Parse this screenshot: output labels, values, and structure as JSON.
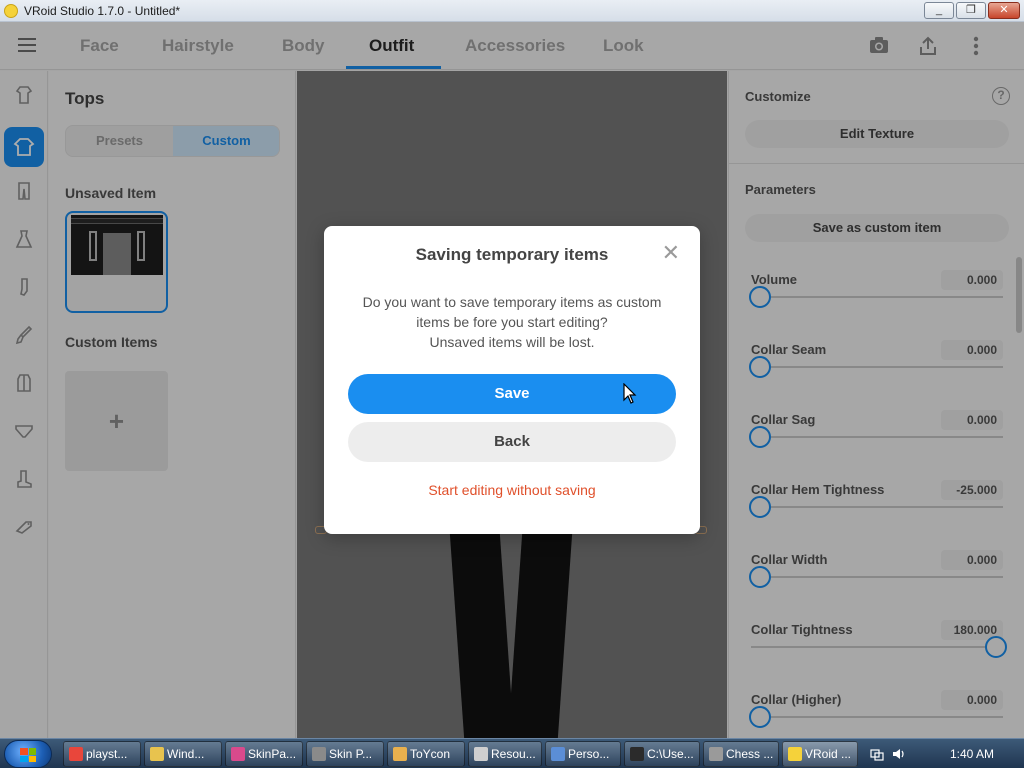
{
  "window": {
    "title": "VRoid Studio 1.7.0 - Untitled*",
    "controls": [
      "_",
      "❐",
      "✕"
    ]
  },
  "nav": {
    "tabs": [
      "Face",
      "Hairstyle",
      "Body",
      "Outfit",
      "Accessories",
      "Look"
    ],
    "active_tab": "Outfit",
    "icons": [
      "camera-icon",
      "share-icon",
      "more-icon"
    ]
  },
  "rail": {
    "items": [
      "outfit-top-icon",
      "shirt-icon",
      "pants-icon",
      "dress-icon",
      "sock-icon",
      "brush-icon",
      "shoe-icon",
      "underwear-icon",
      "boot-icon",
      "accessory-icon"
    ],
    "active_index": 1
  },
  "left_panel": {
    "title": "Tops",
    "segments": [
      "Presets",
      "Custom"
    ],
    "active_segment": "Custom",
    "unsaved_label": "Unsaved Item",
    "custom_label": "Custom Items",
    "add_symbol": "+"
  },
  "right_panel": {
    "customize_heading": "Customize",
    "help_symbol": "?",
    "edit_texture_label": "Edit Texture",
    "parameters_heading": "Parameters",
    "save_custom_label": "Save as custom item",
    "params": [
      {
        "label": "Volume",
        "value": "0.000",
        "fraction": 0.0
      },
      {
        "label": "Collar Seam",
        "value": "0.000",
        "fraction": 0.0
      },
      {
        "label": "Collar Sag",
        "value": "0.000",
        "fraction": 0.0
      },
      {
        "label": "Collar Hem Tightness",
        "value": "-25.000",
        "fraction": 0.0
      },
      {
        "label": "Collar Width",
        "value": "0.000",
        "fraction": 0.0
      },
      {
        "label": "Collar Tightness",
        "value": "180.000",
        "fraction": 1.0
      },
      {
        "label": "Collar (Higher)",
        "value": "0.000",
        "fraction": 0.0
      }
    ]
  },
  "dialog": {
    "title": "Saving temporary items",
    "close_symbol": "✕",
    "message_lines": [
      "Do you want to save temporary items as custom",
      "items be fore you start editing?",
      "Unsaved items will be lost."
    ],
    "save_label": "Save",
    "back_label": "Back",
    "no_save_label": "Start editing without saving"
  },
  "taskbar": {
    "tasks": [
      {
        "label": "playst...",
        "color": "#e9463b"
      },
      {
        "label": "Wind...",
        "color": "#e8c34e"
      },
      {
        "label": "SkinPa...",
        "color": "#d94a8c"
      },
      {
        "label": "Skin P...",
        "color": "#8a8a8a"
      },
      {
        "label": "ToYcon",
        "color": "#e8b04e"
      },
      {
        "label": "Resou...",
        "color": "#cfcfcf"
      },
      {
        "label": "Perso...",
        "color": "#5b8ed6"
      },
      {
        "label": "C:\\Use...",
        "color": "#2b2b2b"
      },
      {
        "label": "Chess ...",
        "color": "#9a9a9a"
      },
      {
        "label": "VRoid ...",
        "color": "#f5d23a"
      }
    ],
    "active_task": "VRoid ...",
    "clock": "1:40 AM"
  },
  "colors": {
    "accent": "#1a8ef0",
    "danger_text": "#e0502b"
  }
}
